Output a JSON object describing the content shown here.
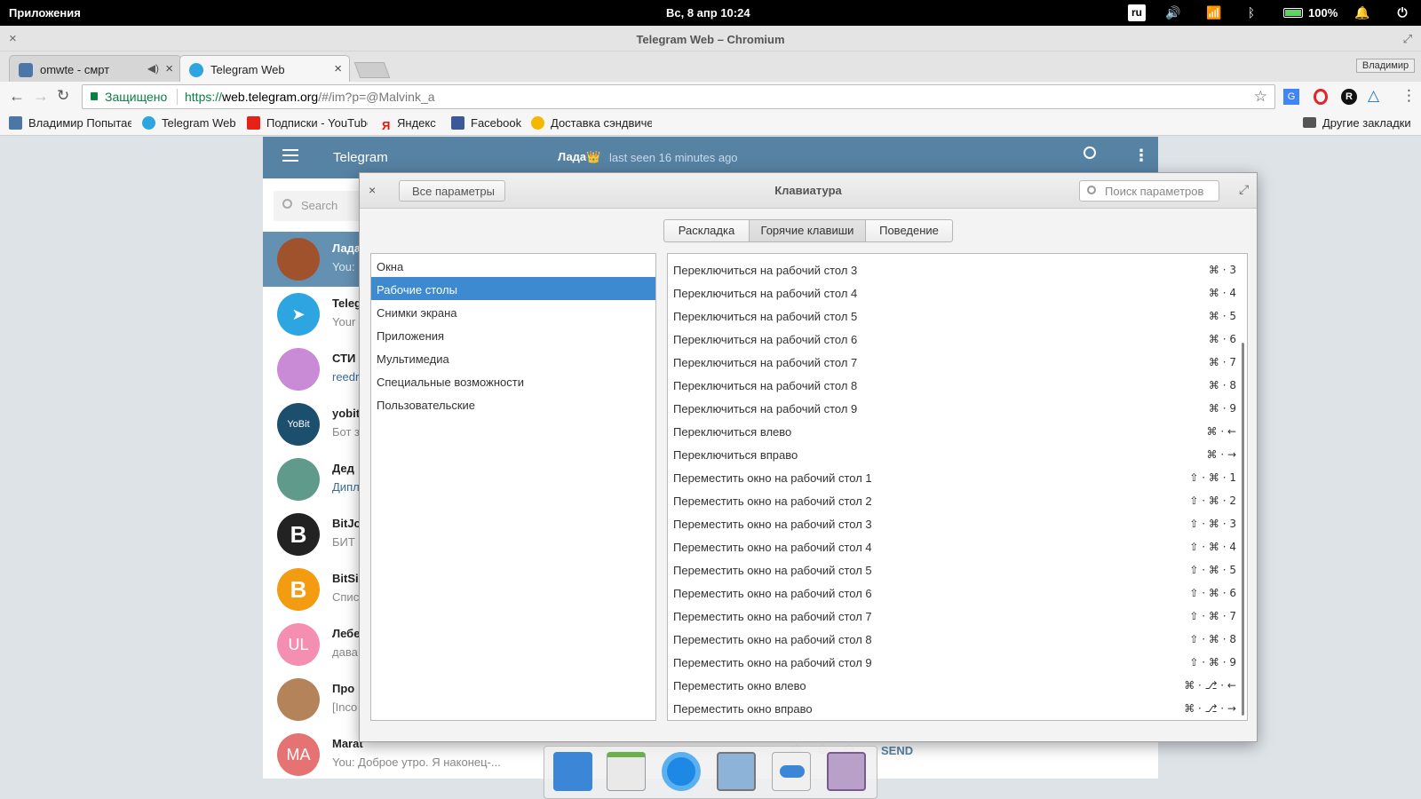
{
  "topbar": {
    "apps_label": "Приложения",
    "datetime": "Вс, 8 апр  10:24",
    "lang": "ru",
    "battery": "100%"
  },
  "window": {
    "title": "Telegram Web – Chromium",
    "profile": "Владимир"
  },
  "tabs": [
    {
      "label": "omwte - смрт"
    },
    {
      "label": "Telegram Web"
    }
  ],
  "address": {
    "secure_label": "Защищено",
    "scheme": "https://",
    "host": "web.telegram.org",
    "path": "/#/im?p=@Malvink_a"
  },
  "bookmarks": [
    {
      "label": "Владимир Попытаев",
      "icon": "vk-icon",
      "color": "#4a76a8"
    },
    {
      "label": "Telegram Web",
      "icon": "telegram-icon",
      "color": "#2ca5e0"
    },
    {
      "label": "Подписки - YouTube",
      "icon": "youtube-icon",
      "color": "#e62117"
    },
    {
      "label": "Яндекс",
      "icon": "yandex-icon",
      "color": "#e61400"
    },
    {
      "label": "Facebook",
      "icon": "facebook-icon",
      "color": "#3b5998"
    },
    {
      "label": "Доставка сэндвичей",
      "icon": "subway-icon",
      "color": "#f5b800"
    }
  ],
  "other_bookmarks": "Другие закладки",
  "telegram": {
    "app_title": "Telegram",
    "peer_name": "Лада👑",
    "peer_status": "last seen 16 minutes ago",
    "search_placeholder": "Search",
    "chats": [
      {
        "name": "Лада",
        "msg": "You:",
        "color": "#a0522d",
        "initials": ""
      },
      {
        "name": "Teleg",
        "msg": "Your",
        "color": "#2ca5e0",
        "initials": ""
      },
      {
        "name": "СТИ",
        "msg": "reedr",
        "color": "#c98bd6",
        "initials": ""
      },
      {
        "name": "yobit",
        "msg": "Бот з",
        "color": "#1c4f6e",
        "initials": ""
      },
      {
        "name": "Дед",
        "msg": "Дипл",
        "color": "#5f9a8b",
        "initials": ""
      },
      {
        "name": "BitJo",
        "msg": "БИТ",
        "color": "#222222",
        "initials": ""
      },
      {
        "name": "BitSi",
        "msg": "Спис",
        "color": "#f39c12",
        "initials": ""
      },
      {
        "name": "Лебе",
        "msg": "дава",
        "color": "#f48fb1",
        "initials": "UL"
      },
      {
        "name": "Про",
        "msg": "[Inco",
        "color": "#b5835a",
        "initials": ""
      },
      {
        "name": "Marat",
        "msg": "You: Доброе утро. Я наконец-...",
        "color": "#e57373",
        "initials": "MA"
      }
    ],
    "send_label": "SEND"
  },
  "dialog": {
    "title": "Клавиатура",
    "back_label": "Все параметры",
    "search_placeholder": "Поиск параметров",
    "tabs": [
      "Раскладка",
      "Горячие клавиши",
      "Поведение"
    ],
    "active_tab": "Горячие клавиши",
    "categories": [
      "Окна",
      "Рабочие столы",
      "Снимки экрана",
      "Приложения",
      "Мультимедиа",
      "Специальные возможности",
      "Пользовательские"
    ],
    "selected_category": "Рабочие столы",
    "shortcuts": [
      {
        "name": "Переключиться на рабочий стол 3",
        "keys": "⌘ · 3"
      },
      {
        "name": "Переключиться на рабочий стол 4",
        "keys": "⌘ · 4"
      },
      {
        "name": "Переключиться на рабочий стол 5",
        "keys": "⌘ · 5"
      },
      {
        "name": "Переключиться на рабочий стол 6",
        "keys": "⌘ · 6"
      },
      {
        "name": "Переключиться на рабочий стол 7",
        "keys": "⌘ · 7"
      },
      {
        "name": "Переключиться на рабочий стол 8",
        "keys": "⌘ · 8"
      },
      {
        "name": "Переключиться на рабочий стол 9",
        "keys": "⌘ · 9"
      },
      {
        "name": "Переключиться влево",
        "keys": "⌘ · ←"
      },
      {
        "name": "Переключиться вправо",
        "keys": "⌘ · →"
      },
      {
        "name": "Переместить окно на рабочий стол 1",
        "keys": "⇧ · ⌘ · 1"
      },
      {
        "name": "Переместить окно на рабочий стол 2",
        "keys": "⇧ · ⌘ · 2"
      },
      {
        "name": "Переместить окно на рабочий стол 3",
        "keys": "⇧ · ⌘ · 3"
      },
      {
        "name": "Переместить окно на рабочий стол 4",
        "keys": "⇧ · ⌘ · 4"
      },
      {
        "name": "Переместить окно на рабочий стол 5",
        "keys": "⇧ · ⌘ · 5"
      },
      {
        "name": "Переместить окно на рабочий стол 6",
        "keys": "⇧ · ⌘ · 6"
      },
      {
        "name": "Переместить окно на рабочий стол 7",
        "keys": "⇧ · ⌘ · 7"
      },
      {
        "name": "Переместить окно на рабочий стол 8",
        "keys": "⇧ · ⌘ · 8"
      },
      {
        "name": "Переместить окно на рабочий стол 9",
        "keys": "⇧ · ⌘ · 9"
      },
      {
        "name": "Переместить окно влево",
        "keys": "⌘ · ⎇ · ←"
      },
      {
        "name": "Переместить окно вправо",
        "keys": "⌘ · ⎇ · →"
      }
    ]
  },
  "dock": [
    "multitasking-view-icon",
    "calendar-icon",
    "chromium-icon",
    "photos-icon",
    "settings-toggle-icon",
    "appcenter-icon"
  ]
}
